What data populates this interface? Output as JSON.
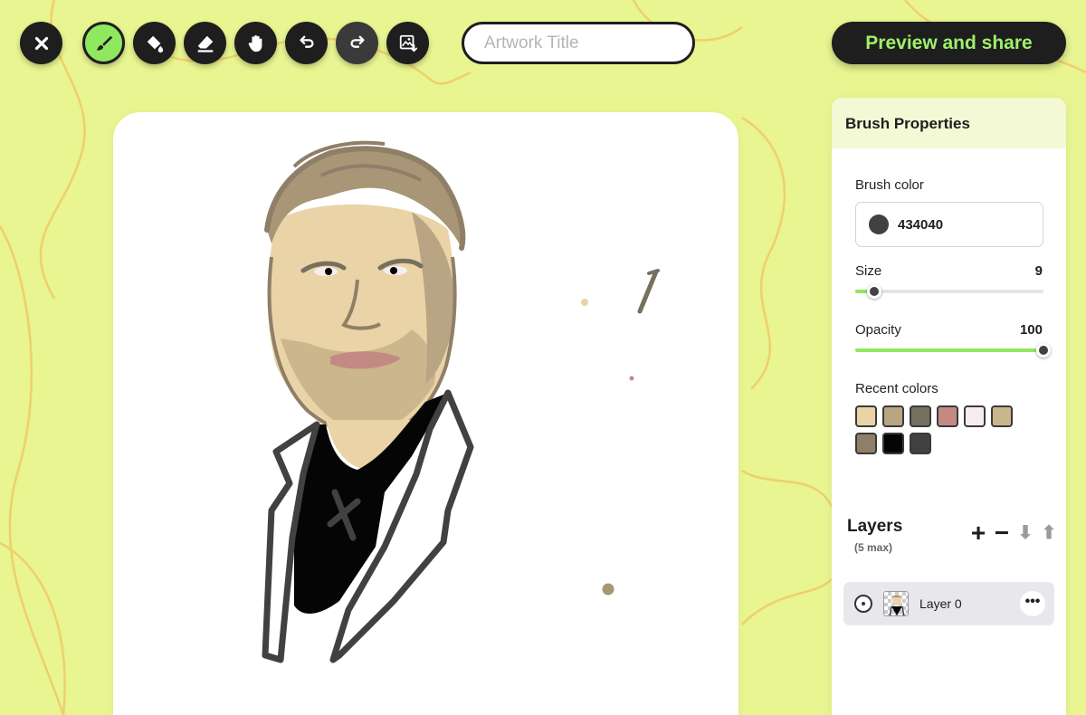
{
  "toolbar": {
    "tools": [
      {
        "name": "close",
        "icon": "close-icon"
      },
      {
        "name": "brush",
        "icon": "brush-icon",
        "active": true
      },
      {
        "name": "fill",
        "icon": "fill-icon"
      },
      {
        "name": "eraser",
        "icon": "eraser-icon"
      },
      {
        "name": "pan",
        "icon": "hand-icon"
      },
      {
        "name": "undo",
        "icon": "undo-icon"
      },
      {
        "name": "redo",
        "icon": "redo-icon"
      },
      {
        "name": "image",
        "icon": "add-image-icon"
      }
    ],
    "title_placeholder": "Artwork Title",
    "title_value": "",
    "share_label": "Preview and share"
  },
  "brush_panel": {
    "heading": "Brush Properties",
    "color_label": "Brush color",
    "color_hex": "434040",
    "color": "#434040",
    "size_label": "Size",
    "size_value": "9",
    "size_fraction": 0.09,
    "opacity_label": "Opacity",
    "opacity_value": "100",
    "opacity_fraction": 1.0,
    "recent_label": "Recent colors",
    "recent_colors": [
      "#ead3a6",
      "#b9a584",
      "#76705f",
      "#c38a84",
      "#f6eeee",
      "#cbb68b",
      "#8f7f68",
      "#050505",
      "#434040"
    ]
  },
  "layers": {
    "title": "Layers",
    "subtitle": "(5 max)",
    "actions": [
      "+",
      "−",
      "⬇",
      "⬆"
    ],
    "items": [
      {
        "name": "Layer 0",
        "more": "•••"
      }
    ]
  },
  "colors": {
    "background": "#e8f590",
    "accent": "#8fe85e",
    "dark": "#1e1e1e"
  }
}
